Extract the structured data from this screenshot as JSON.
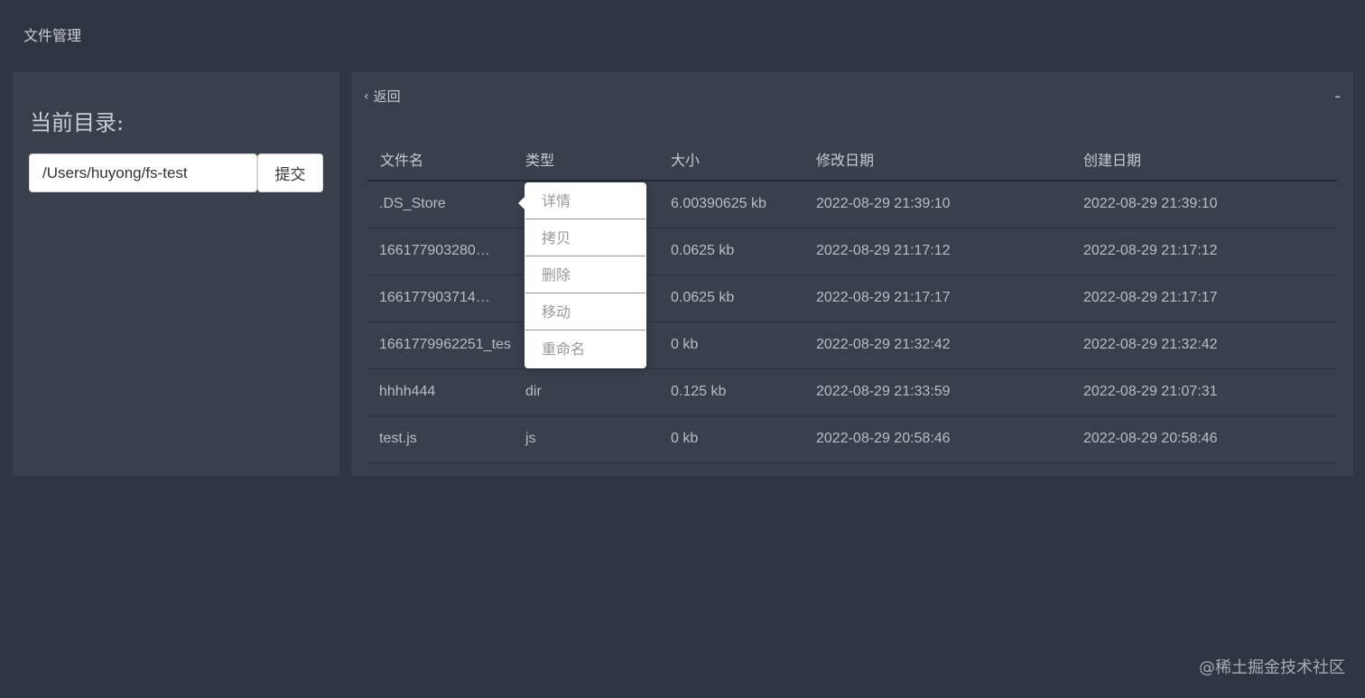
{
  "app": {
    "title": "文件管理"
  },
  "left": {
    "dir_label": "当前目录:",
    "path_value": "/Users/huyong/fs-test",
    "submit_label": "提交"
  },
  "right": {
    "back_label": "返回",
    "minimize_label": "-"
  },
  "table": {
    "headers": [
      "文件名",
      "类型",
      "大小",
      "修改日期",
      "创建日期"
    ],
    "rows": [
      {
        "name": ".DS_Store",
        "type": "",
        "size": "6.00390625 kb",
        "modified": "2022-08-29 21:39:10",
        "created": "2022-08-29 21:39:10"
      },
      {
        "name": "166177903280…",
        "type": "",
        "size": "0.0625 kb",
        "modified": "2022-08-29 21:17:12",
        "created": "2022-08-29 21:17:12"
      },
      {
        "name": "166177903714…",
        "type": "",
        "size": "0.0625 kb",
        "modified": "2022-08-29 21:17:17",
        "created": "2022-08-29 21:17:17"
      },
      {
        "name": "1661779962251_tes",
        "type": "",
        "size": "0 kb",
        "modified": "2022-08-29 21:32:42",
        "created": "2022-08-29 21:32:42"
      },
      {
        "name": "hhhh444",
        "type": "dir",
        "size": "0.125 kb",
        "modified": "2022-08-29 21:33:59",
        "created": "2022-08-29 21:07:31"
      },
      {
        "name": "test.js",
        "type": "js",
        "size": "0 kb",
        "modified": "2022-08-29 20:58:46",
        "created": "2022-08-29 20:58:46"
      }
    ]
  },
  "context_menu": {
    "items": [
      "详情",
      "拷贝",
      "删除",
      "移动",
      "重命名"
    ]
  },
  "watermark": "@稀土掘金技术社区"
}
